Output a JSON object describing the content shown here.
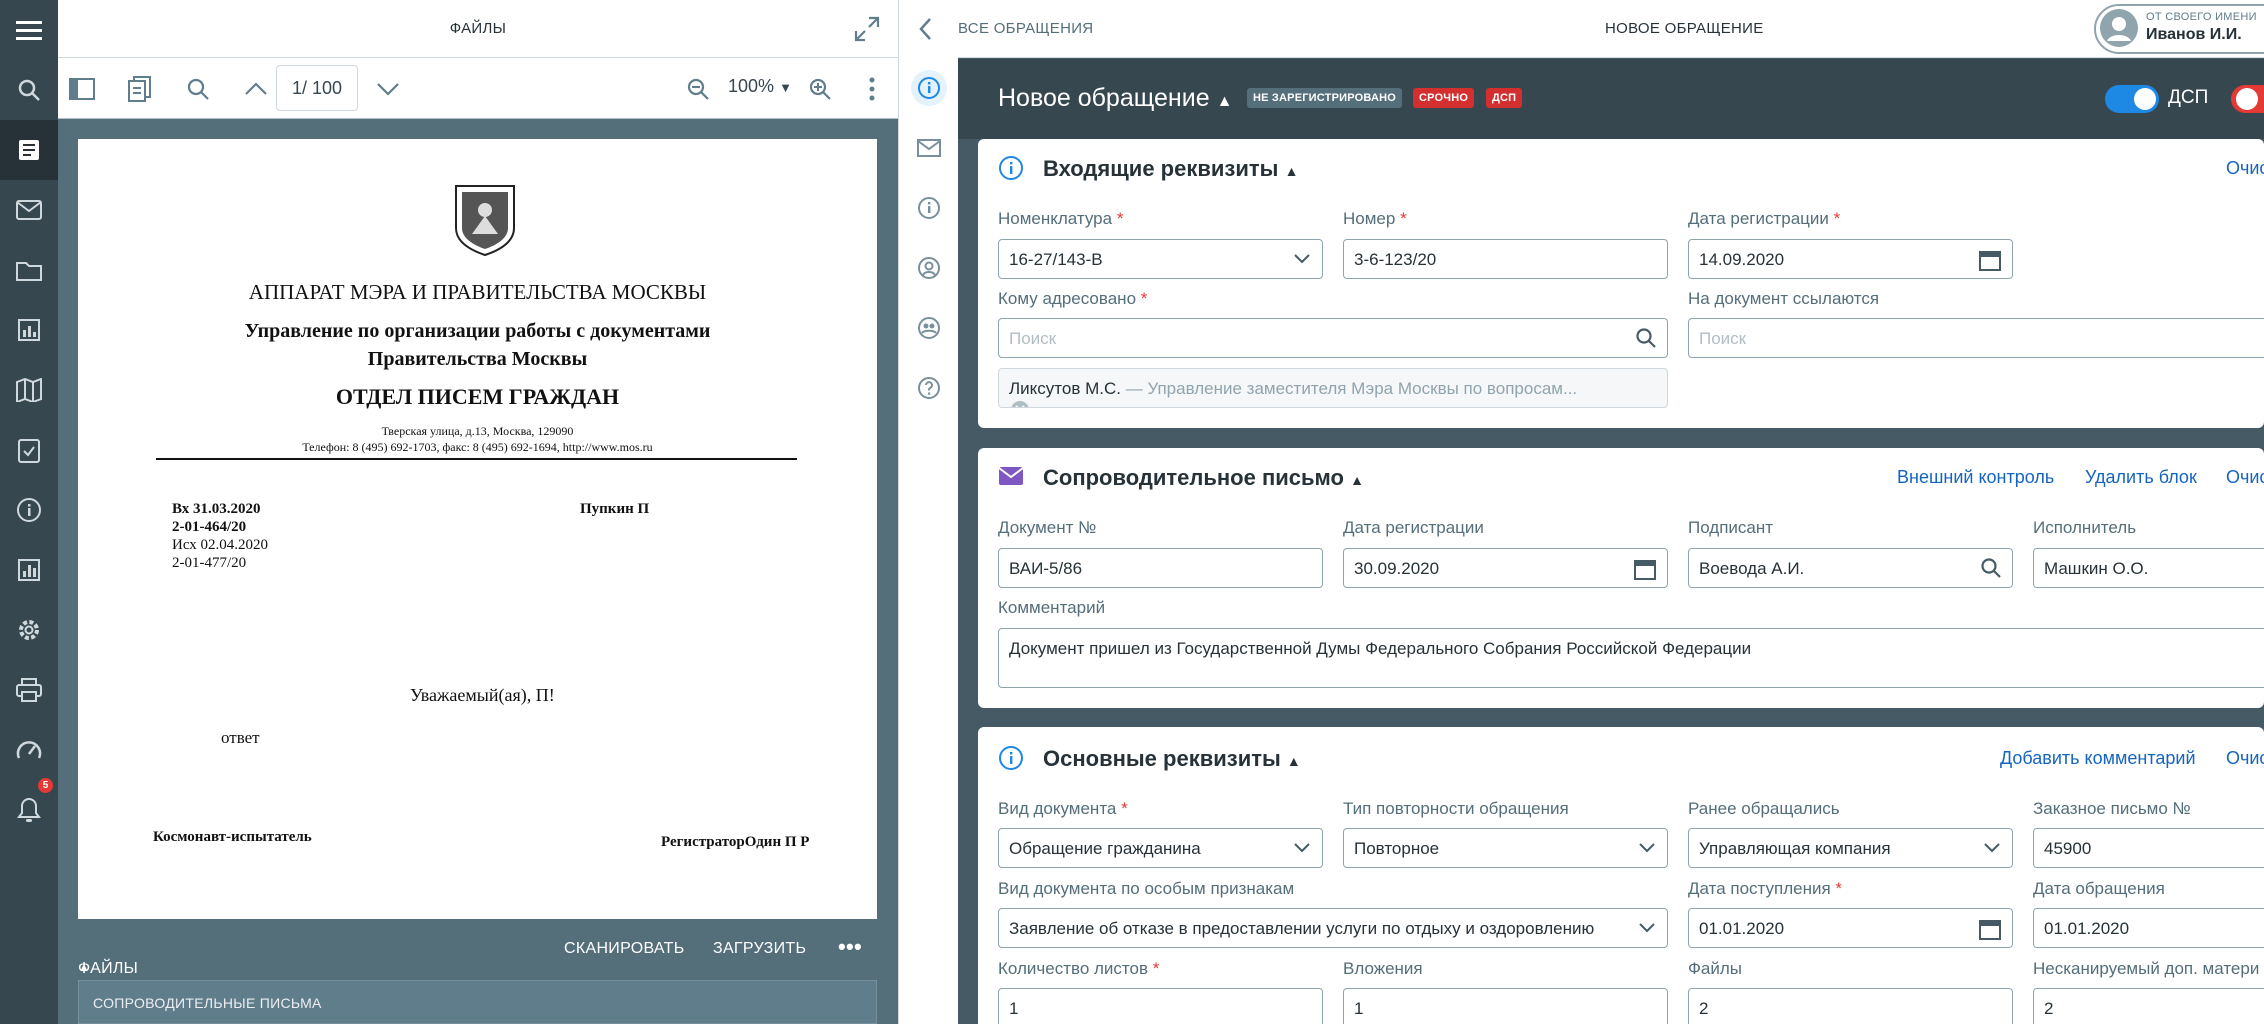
{
  "rail": {
    "items": [
      "menu",
      "search",
      "registry",
      "mail",
      "folder",
      "reports",
      "map",
      "tasks",
      "info",
      "stats",
      "settings",
      "print",
      "dashboard",
      "notifications"
    ],
    "notifications_count": "5"
  },
  "viewer": {
    "title": "ФАЙЛЫ",
    "page_indicator": "1/ 100",
    "zoom": "100%",
    "files_label": "ФАЙЛЫ",
    "scan_label": "СКАНИРОВАТЬ",
    "upload_label": "ЗАГРУЗИТЬ",
    "accordion_label": "СОПРОВОДИТЕЛЬНЫЕ ПИСЬМА"
  },
  "doc": {
    "org": "АППАРАТ МЭРА И ПРАВИТЕЛЬСТВА МОСКВЫ",
    "dept1": "Управление по организации работы с документами",
    "dept2": "Правительства Москвы",
    "division": "ОТДЕЛ ПИСЕМ ГРАЖДАН",
    "address": "Тверская улица, д.13, Москва, 129090",
    "phones": "Телефон: 8 (495) 692-1703, факс: 8 (495) 692-1694, http://www.mos.ru",
    "in_date": "Вх 31.03.2020",
    "in_num": "2-01-464/20",
    "out_date": "Исх 02.04.2020",
    "out_num": "2-01-477/20",
    "addressee": "Пупкин П",
    "greeting": "Уважаемый(ая), П!",
    "body": "ответ",
    "sign_left": "Космонавт-испытатель",
    "sign_right": "РегистраторОдин П Р"
  },
  "topbar": {
    "crumb": "ВСЕ ОБРАЩЕНИЯ",
    "title": "НОВОЕ ОБРАЩЕНИЕ",
    "user_role": "ОТ СВОЕГО ИМЕНИ",
    "user_name": "Иванов И.И."
  },
  "form": {
    "title": "Новое обращение",
    "badge_status": "НЕ ЗАРЕГИСТРИРОВАНО",
    "badge_urgent": "СРОЧНО",
    "badge_dsp": "ДСП",
    "dsp_toggle_label": "ДСП",
    "dsp_toggle_on": true,
    "colors": {
      "accent": "#1e88e5",
      "danger": "#d32f2f",
      "header": "#37474f"
    }
  },
  "incoming": {
    "title": "Входящие реквизиты",
    "clear_link": "Очис",
    "nomenclature_label": "Номенклатура",
    "nomenclature_value": "16-27/143-В",
    "number_label": "Номер",
    "number_value": "3-6-123/20",
    "reg_date_label": "Дата регистрации",
    "reg_date_value": "14.09.2020",
    "addressed_label": "Кому адресовано",
    "addressed_placeholder": "Поиск",
    "addressee_chip_name": "Ликсутов М.С.",
    "addressee_chip_desc": "— Управление заместителя Мэра Москвы по вопросам...",
    "refs_label": "На документ ссылаются",
    "refs_placeholder": "Поиск"
  },
  "cover": {
    "title": "Сопроводительное письмо",
    "external_link": "Внешний контроль",
    "delete_link": "Удалить блок",
    "clear_link": "Очис",
    "doc_no_label": "Документ №",
    "doc_no_value": "ВАИ-5/86",
    "reg_date_label": "Дата регистрации",
    "reg_date_value": "30.09.2020",
    "signer_label": "Подписант",
    "signer_value": "Воевода А.И.",
    "executor_label": "Исполнитель",
    "executor_value": "Машкин О.О.",
    "comment_label": "Комментарий",
    "comment_value": "Документ пришел из Государственной Думы Федерального Собрания Российской Федерации"
  },
  "main": {
    "title": "Основные реквизиты",
    "add_comment_link": "Добавить комментарий",
    "clear_link": "Очис",
    "doc_type_label": "Вид документа",
    "doc_type_value": "Обращение гражданина",
    "repeat_label": "Тип повторности обращения",
    "repeat_value": "Повторное",
    "before_label": "Ранее обращались",
    "before_value": "Управляющая компания",
    "registered_label": "Заказное письмо №",
    "registered_value": "45900",
    "special_label": "Вид документа по особым признакам",
    "special_value": "Заявление об отказе в предоставлении услуги по отдыху и оздоровлению",
    "received_label": "Дата поступления",
    "received_value": "01.01.2020",
    "appeal_date_label": "Дата обращения",
    "appeal_date_value": "01.01.2020",
    "sheets_label": "Количество листов",
    "sheets_value": "1",
    "attachments_label": "Вложения",
    "attachments_value": "1",
    "files_label": "Файлы",
    "files_value": "2",
    "unscanned_label": "Нескан­ируемый доп. матери",
    "unscanned_value": "2"
  }
}
